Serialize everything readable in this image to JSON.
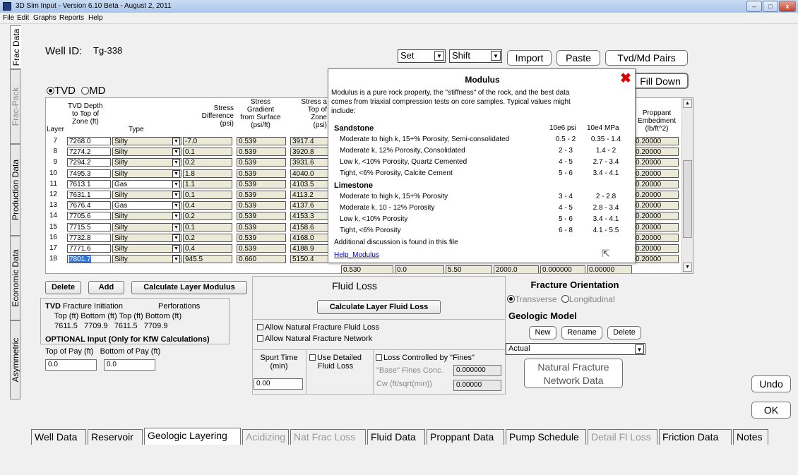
{
  "window": {
    "title": "3D Sim Input - Version 6.10 Beta - August 2, 2011"
  },
  "menu": [
    "File",
    "Edit",
    "Graphs",
    "Reports",
    "Help"
  ],
  "side_tabs": [
    "Frac Data",
    "Frac-Pack",
    "Production Data",
    "Economic Data",
    "Asymmetric"
  ],
  "well": {
    "label": "Well ID:",
    "value": "Tg-338"
  },
  "toolbar": {
    "set": "Set",
    "shift": "Shift",
    "import": "Import",
    "paste": "Paste",
    "pairs": "Tvd/Md Pairs",
    "fill_down": "Fill Down"
  },
  "depth_mode": {
    "tvd": "TVD",
    "md": "MD",
    "selected": "TVD"
  },
  "grid": {
    "headers": {
      "layer": "Layer",
      "depth": [
        "TVD Depth",
        "to Top of",
        "Zone (ft)"
      ],
      "type": "Type",
      "stress_diff": [
        "Stress",
        "Difference",
        "(psi)"
      ],
      "gradient": [
        "Stress",
        "Gradient",
        "from Surface",
        "(psi/ft)"
      ],
      "stress_top": [
        "Stress a",
        "Top of",
        "Zone",
        "(psi)"
      ],
      "proppant": [
        "Proppant",
        "Embedment",
        "(lb/ft^2)"
      ]
    },
    "rows": [
      {
        "layer": "7",
        "depth": "7268.0",
        "type": "Silty",
        "diff": "-7.0",
        "grad": "0.539",
        "stress": "3917.4",
        "prop": "0.20000"
      },
      {
        "layer": "8",
        "depth": "7274.2",
        "type": "Silty",
        "diff": "0.1",
        "grad": "0.539",
        "stress": "3920.8",
        "prop": "0.20000"
      },
      {
        "layer": "9",
        "depth": "7294.2",
        "type": "Silty",
        "diff": "0.2",
        "grad": "0.539",
        "stress": "3931.6",
        "prop": "0.20000"
      },
      {
        "layer": "10",
        "depth": "7495.3",
        "type": "Silty",
        "diff": "1.8",
        "grad": "0.539",
        "stress": "4040.0",
        "prop": "0.20000"
      },
      {
        "layer": "11",
        "depth": "7613.1",
        "type": "Gas",
        "diff": "1.1",
        "grad": "0.539",
        "stress": "4103.5",
        "prop": "0.20000"
      },
      {
        "layer": "12",
        "depth": "7631.1",
        "type": "Silty",
        "diff": "0.1",
        "grad": "0.539",
        "stress": "4113.2",
        "prop": "0.20000"
      },
      {
        "layer": "13",
        "depth": "7676.4",
        "type": "Gas",
        "diff": "0.4",
        "grad": "0.539",
        "stress": "4137.6",
        "prop": "0.20000"
      },
      {
        "layer": "14",
        "depth": "7705.6",
        "type": "Silty",
        "diff": "0.2",
        "grad": "0.539",
        "stress": "4153.3",
        "prop": "0.20000"
      },
      {
        "layer": "15",
        "depth": "7715.5",
        "type": "Silty",
        "diff": "0.1",
        "grad": "0.539",
        "stress": "4158.6",
        "prop": "0.20000"
      },
      {
        "layer": "16",
        "depth": "7732.8",
        "type": "Silty",
        "diff": "0.2",
        "grad": "0.539",
        "stress": "4168.0",
        "prop": "0.20000"
      },
      {
        "layer": "17",
        "depth": "7771.6",
        "type": "Silty",
        "diff": "0.4",
        "grad": "0.539",
        "stress": "4188.9",
        "prop": "0.20000"
      },
      {
        "layer": "18",
        "depth": "7801.7",
        "type": "Silty",
        "diff": "945.5",
        "grad": "0.660",
        "stress": "5150.4",
        "prop": "0.20000"
      }
    ],
    "last_row_extra": [
      "0.530",
      "0.0",
      "5.50",
      "2000.0",
      "0.000000",
      "0.00000"
    ]
  },
  "popup": {
    "title": "Modulus",
    "intro": [
      "Modulus is a pure rock property, the \"stiffness\" of the rock, and the best data",
      "comes from triaxial compression tests on core samples. Typical values might",
      "include:"
    ],
    "units": [
      "10e6 psi",
      "10e4 MPa"
    ],
    "sandstone": {
      "title": "Sandstone",
      "rows": [
        {
          "desc": "Moderate to high k, 15+% Porosity, Semi-consolidated",
          "psi": "0.5 - 2",
          "mpa": "0.35 - 1.4"
        },
        {
          "desc": "Moderate k, 12% Porosity, Consolidated",
          "psi": "2 - 3",
          "mpa": "1.4 - 2"
        },
        {
          "desc": "Low k, <10% Porosity, Quartz Cemented",
          "psi": "4 - 5",
          "mpa": "2.7 - 3.4"
        },
        {
          "desc": "Tight, <6% Porosity, Calcite Cement",
          "psi": "5 - 6",
          "mpa": "3.4 - 4.1"
        }
      ]
    },
    "limestone": {
      "title": "Limestone",
      "rows": [
        {
          "desc": "Moderate to high k, 15+% Porosity",
          "psi": "3 - 4",
          "mpa": "2 - 2.8"
        },
        {
          "desc": "Moderate k, 10 - 12% Porosity",
          "psi": "4 - 5",
          "mpa": "2.8 - 3.4"
        },
        {
          "desc": "Low k, <10% Porosity",
          "psi": "5 - 6",
          "mpa": "3.4 - 4.1"
        },
        {
          "desc": "Tight, <6% Porosity",
          "psi": "6 - 8",
          "mpa": "4.1 - 5.5"
        }
      ]
    },
    "footer": "Additional discussion is found in this file",
    "link": "Help_Modulus"
  },
  "layer_buttons": {
    "delete": "Delete",
    "add": "Add",
    "calc_modulus": "Calculate Layer Modulus"
  },
  "tvd_box": {
    "tvd": "TVD",
    "frac_init": "Fracture Initiation",
    "perfs": "Perforations",
    "sub": "Top (ft) Bottom (ft) Top (ft) Bottom (ft)",
    "values": "7611.5   7709.9   7611.5   7709.9",
    "optional": "OPTIONAL Input (Only for KfW Calculations)",
    "pay_labels": "Top of Pay (ft)   Bottom of Pay (ft)",
    "top_pay": "0.0",
    "bottom_pay": "0.0"
  },
  "fluid_loss": {
    "title": "Fluid Loss",
    "calc": "Calculate Layer Fluid Loss",
    "allow_nf_loss": "Allow Natural Fracture Fluid Loss",
    "allow_nf_network": "Allow Natural Fracture Network",
    "spurt_label": [
      "Spurt Time",
      "(min)"
    ],
    "spurt_value": "0.00",
    "detailed": [
      "Use Detailed",
      "Fluid Loss"
    ],
    "fines": "Loss Controlled by \"Fines\"",
    "base_fines": "\"Base\" Fines Conc.",
    "base_fines_value": "0.000000",
    "cw": "Cw (ft/sqrt(min))",
    "cw_value": "0.00000"
  },
  "orientation": {
    "title": "Fracture Orientation",
    "transverse": "Transverse",
    "longitudinal": "Longitudinal"
  },
  "geo_model": {
    "title": "Geologic Model",
    "new": "New",
    "rename": "Rename",
    "delete": "Delete",
    "selected": "Actual"
  },
  "nat_frac": [
    "Natural Fracture",
    "Network Data"
  ],
  "undo": "Undo",
  "ok": "OK",
  "bottom_tabs": [
    "Well Data",
    "Reservoir",
    "Geologic Layering",
    "Acidizing",
    "Nat Frac Loss",
    "Fluid Data",
    "Proppant Data",
    "Pump Schedule",
    "Detail Fl Loss",
    "Friction Data",
    "Notes"
  ]
}
